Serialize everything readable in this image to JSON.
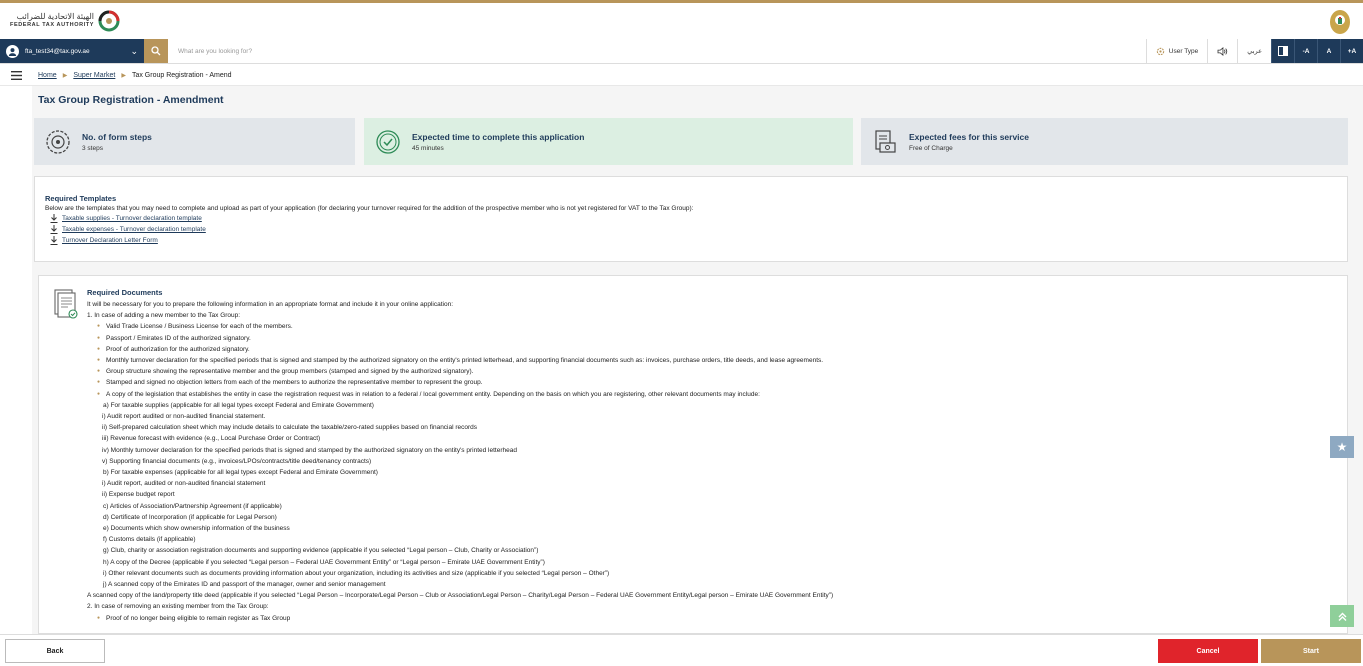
{
  "header": {
    "logo_ar": "الهيئة الاتحادية للضرائب",
    "logo_en": "FEDERAL TAX AUTHORITY"
  },
  "navbar": {
    "user_email": "fta_test34@tax.gov.ae",
    "search_placeholder": "What are you looking for?",
    "user_type_label": "User Type",
    "arabic_label": "عربي",
    "font_minus": "-A",
    "font_normal": "A",
    "font_plus": "+A"
  },
  "breadcrumb": {
    "home": "Home",
    "parent": "Super Market",
    "current": "Tax Group Registration - Amend"
  },
  "page": {
    "title": "Tax Group Registration - Amendment"
  },
  "cards": [
    {
      "title": "No. of form steps",
      "value": "3 steps",
      "bg": "#e2e6ea"
    },
    {
      "title": "Expected time to complete this application",
      "value": "45 minutes",
      "bg": "#dcefe2"
    },
    {
      "title": "Expected fees for this service",
      "value": "Free of Charge",
      "bg": "#e2e6ea"
    }
  ],
  "templates": {
    "title": "Required Templates",
    "intro": "Below are the templates that you may need to complete and upload as part of your application (for declaring your turnover required for the addition of the prospective member who is not yet registered for VAT to the Tax Group):",
    "links": [
      "Taxable supplies - Turnover declaration template",
      "Taxable expenses - Turnover declaration template",
      "Turnover Declaration Letter Form"
    ]
  },
  "documents": {
    "title": "Required Documents",
    "lines": [
      "It will be necessary for you to prepare the following information in an appropriate format and include it in your online application:",
      "1. In case of adding a new member to the Tax Group:",
      "Valid Trade License / Business License for each of the members.",
      "Passport / Emirates ID of the authorized signatory.",
      "Proof of authorization for the authorized signatory.",
      "Monthly turnover declaration for the specified periods that is signed and stamped by the authorized signatory on the entity's printed letterhead, and supporting financial documents such as: invoices, purchase orders, title deeds, and lease agreements.",
      "Group structure showing the representative member and the group members (stamped and signed by the authorized signatory).",
      "Stamped and signed no objection letters from each of the members to authorize the representative member to represent the group.",
      "A copy of the legislation that establishes the entity in case the registration request was in relation to a federal / local government entity. Depending on the basis on which you are registering, other relevant documents may include:",
      "a) For taxable supplies (applicable for all legal types except Federal and Emirate Government)",
      "i) Audit report audited or non-audited financial statement.",
      "ii) Self-prepared calculation sheet which may include details to calculate the taxable/zero-rated supplies based on financial records",
      "iii) Revenue forecast with evidence (e.g., Local Purchase Order or Contract)",
      "iv) Monthly turnover declaration for the specified periods that is signed and stamped by the authorized signatory on the entity's printed letterhead",
      "v) Supporting financial documents (e.g., invoices/LPOs/contracts/title deed/tenancy contracts)",
      "b) For taxable expenses (applicable for all legal types except Federal and Emirate Government)",
      "i) Audit report, audited or non-audited financial statement",
      "ii) Expense budget report",
      "c) Articles of Association/Partnership Agreement (if applicable)",
      "d) Certificate of Incorporation (if applicable for Legal Person)",
      "e) Documents which show ownership information of the business",
      "f) Customs details (if applicable)",
      "g) Club, charity or association registration documents and supporting evidence (applicable if you selected “Legal person – Club, Charity or Association”)",
      "h) A copy of the Decree (applicable if you selected “Legal person – Federal UAE Government Entity” or “Legal person – Emirate UAE Government Entity”)",
      "i) Other relevant documents such as documents providing information about your organization, including its activities and size (applicable if you selected “Legal person – Other”)",
      "j) A scanned copy of the Emirates ID and passport of the manager, owner and senior management",
      "A scanned copy of the land/property title deed (applicable if you selected “Legal Person – Incorporate/Legal Person – Club or Association/Legal Person – Charity/Legal Person – Federal UAE Government Entity/Legal person – Emirate UAE Government Entity”)",
      "2. In case of removing an existing member from the Tax Group:",
      "Proof of no longer being eligible to remain register as Tax Group"
    ]
  },
  "footer": {
    "back": "Back",
    "cancel": "Cancel",
    "start": "Start"
  },
  "colors": {
    "brand_navy": "#1e3a5a",
    "brand_gold": "#b8955a",
    "cancel_red": "#e0242b"
  }
}
